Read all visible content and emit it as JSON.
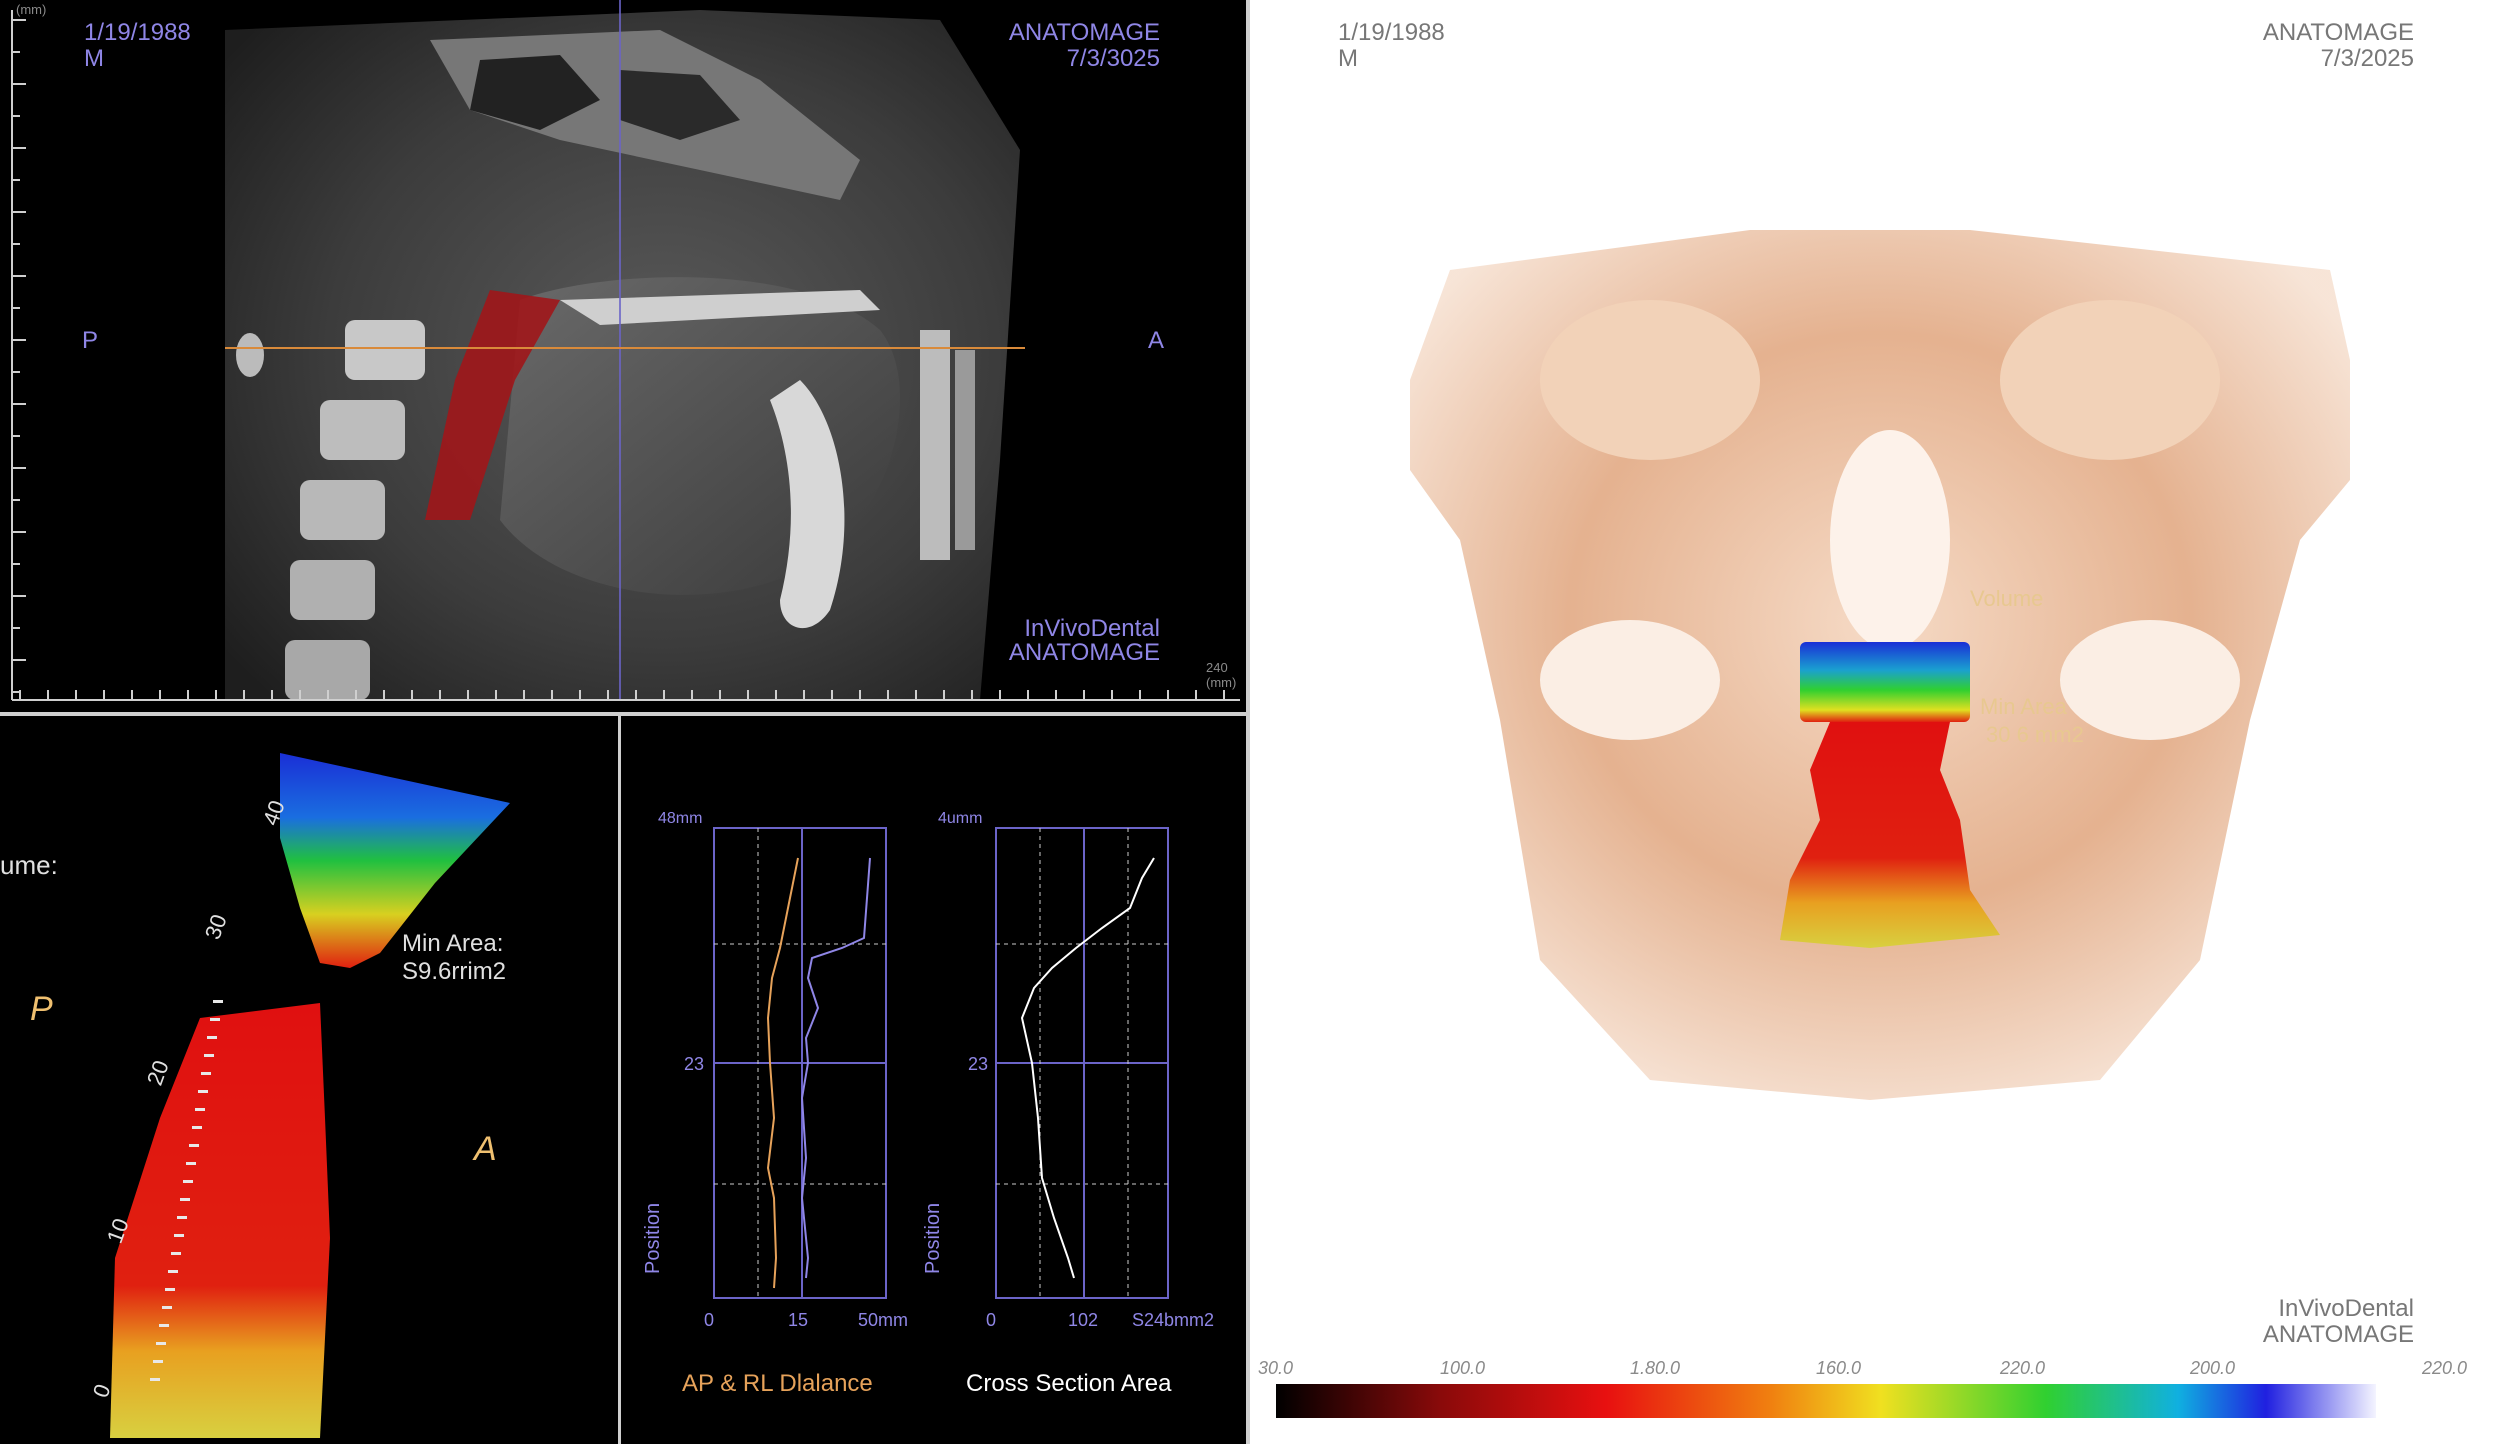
{
  "sagittal": {
    "patient_dob": "1/19/1988",
    "patient_sex": "M",
    "brand": "ANATOMAGE",
    "scan_date": "7/3/3025",
    "orient_posterior": "P",
    "orient_anterior": "A",
    "product": "InVivoDental",
    "product_brand": "ANATOMAGE",
    "ruler_unit": "(mm)",
    "ruler_end": "240 (mm)"
  },
  "airway3d": {
    "volume_label": "ume:",
    "min_area_label": "Min Area:",
    "min_area_value": "S9.6rrim2",
    "orient_posterior": "P",
    "orient_anterior": "A",
    "scale_ticks": [
      "40",
      "30",
      "20",
      "10",
      "0"
    ]
  },
  "graphs": {
    "left": {
      "top_label": "48mm",
      "mid_label": "23",
      "y_axis": "Position",
      "x_ticks": [
        "0",
        "15",
        "50mm"
      ],
      "title": "AP & RL Dlalance"
    },
    "right": {
      "top_label": "4umm",
      "mid_label": "23",
      "y_axis": "Position",
      "x_ticks": [
        "0",
        "102",
        "S24bmm2"
      ],
      "title": "Cross Section Area"
    },
    "colors": {
      "ap_line": "#e6a25a",
      "rl_line": "#8f86e6",
      "area_line": "#ffffff",
      "frame": "#6b64c8"
    }
  },
  "volume": {
    "patient_dob": "1/19/1988",
    "patient_sex": "M",
    "brand": "ANATOMAGE",
    "scan_date": "7/3/2025",
    "product": "InVivoDental",
    "product_brand": "ANATOMAGE",
    "volume_label": "Volume",
    "min_area_label": "Min Area",
    "min_area_value": "30 6 mm2",
    "colorbar_ticks": [
      "30.0",
      "100.0",
      "1.80.0",
      "160.0",
      "220.0",
      "200.0",
      "220.0"
    ]
  }
}
